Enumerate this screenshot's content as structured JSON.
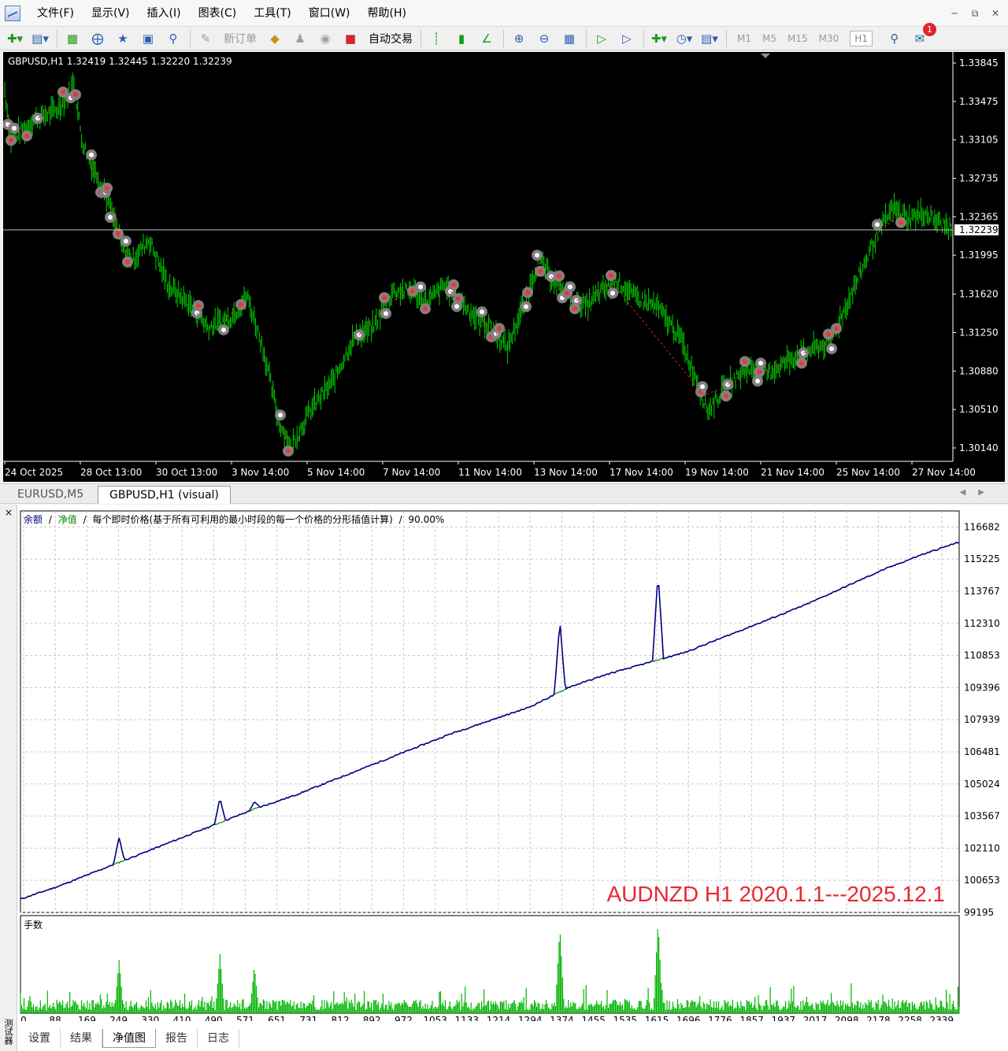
{
  "menu": {
    "items": [
      "文件(F)",
      "显示(V)",
      "插入(I)",
      "图表(C)",
      "工具(T)",
      "窗口(W)",
      "帮助(H)"
    ],
    "window_controls": [
      "minimize-icon",
      "restore-icon",
      "close-icon"
    ]
  },
  "toolbar": {
    "new_order_label": "新订单",
    "auto_trading_label": "自动交易",
    "timeframes": [
      "M1",
      "M5",
      "M15",
      "M30",
      "H1"
    ],
    "active_timeframe": "H1",
    "notification_count": "1"
  },
  "price_chart": {
    "header": "GBPUSD,H1  1.32419 1.32445 1.32220 1.32239",
    "current_price": "1.32239",
    "price_ticks": [
      "1.33845",
      "1.33475",
      "1.33105",
      "1.32735",
      "1.32365",
      "1.31995",
      "1.31620",
      "1.31250",
      "1.30880",
      "1.30510",
      "1.30140"
    ],
    "time_ticks": [
      "24 Oct 2025",
      "28 Oct 13:00",
      "30 Oct 13:00",
      "3 Nov 14:00",
      "5 Nov 14:00",
      "7 Nov 14:00",
      "11 Nov 14:00",
      "13 Nov 14:00",
      "17 Nov 14:00",
      "19 Nov 14:00",
      "21 Nov 14:00",
      "25 Nov 14:00",
      "27 Nov 14:00"
    ],
    "colors": {
      "background": "#000000",
      "bars": "#00d000",
      "grid": "#303030",
      "text": "#ffffff"
    }
  },
  "chart_tabs": [
    {
      "label": "EURUSD,M5",
      "active": false
    },
    {
      "label": "GBPUSD,H1 (visual)",
      "active": true
    }
  ],
  "tester": {
    "close_label": "×",
    "side_label": "测试器",
    "legend": {
      "balance": "余额",
      "equity": "净值",
      "description": "每个即时价格(基于所有可利用的最小时段的每一个价格的分形插值计算)",
      "quality": "90.00%",
      "sep": "/"
    },
    "volume_label": "手数",
    "caption": "AUDNZD H1 2020.1.1---2025.12.1",
    "y_ticks": [
      "116682",
      "115225",
      "113767",
      "112310",
      "110853",
      "109396",
      "107939",
      "106481",
      "105024",
      "103567",
      "102110",
      "100653",
      "99195"
    ],
    "x_ticks": [
      "0",
      "88",
      "169",
      "249",
      "330",
      "410",
      "490",
      "571",
      "651",
      "731",
      "812",
      "892",
      "972",
      "1053",
      "1133",
      "1214",
      "1294",
      "1374",
      "1455",
      "1535",
      "1615",
      "1696",
      "1776",
      "1857",
      "1937",
      "2017",
      "2098",
      "2178",
      "2258",
      "2339"
    ],
    "tabs": [
      {
        "label": "设置",
        "active": false
      },
      {
        "label": "结果",
        "active": false
      },
      {
        "label": "净值图",
        "active": true
      },
      {
        "label": "报告",
        "active": false
      },
      {
        "label": "日志",
        "active": false
      }
    ],
    "colors": {
      "balance": "#000080",
      "equity": "#008000",
      "volume": "#00b400",
      "caption": "#e8282e"
    }
  },
  "chart_data": {
    "type": "line",
    "title": "",
    "xlabel": "",
    "ylabel": "",
    "xlim": [
      0,
      2400
    ],
    "ylim": [
      99195,
      117500
    ],
    "series": [
      {
        "name": "余额",
        "x": [
          0,
          100,
          200,
          300,
          400,
          500,
          600,
          700,
          800,
          900,
          1000,
          1100,
          1200,
          1300,
          1380,
          1400,
          1500,
          1600,
          1700,
          1800,
          1900,
          2000,
          2100,
          2200,
          2300,
          2400
        ],
        "values": [
          99800,
          100400,
          101100,
          101800,
          102500,
          103200,
          103900,
          104500,
          105200,
          105900,
          106600,
          107300,
          107900,
          108500,
          109200,
          109400,
          110000,
          110500,
          111000,
          111700,
          112400,
          113100,
          113900,
          114700,
          115400,
          116000
        ]
      }
    ],
    "equity_spikes": [
      {
        "x": 252,
        "value": 102600
      },
      {
        "x": 510,
        "value": 104400
      },
      {
        "x": 598,
        "value": 104200
      },
      {
        "x": 1379,
        "value": 112400
      },
      {
        "x": 1630,
        "value": 114600
      }
    ],
    "volume_spikes": [
      {
        "x": 252,
        "value": 0.9
      },
      {
        "x": 510,
        "value": 1.0
      },
      {
        "x": 598,
        "value": 0.8
      },
      {
        "x": 1379,
        "value": 1.45
      },
      {
        "x": 1630,
        "value": 1.55
      }
    ]
  }
}
